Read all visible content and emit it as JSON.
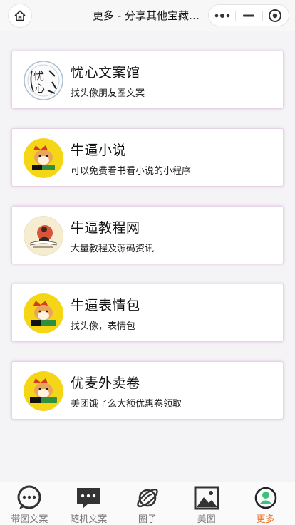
{
  "navbar": {
    "title": "更多 - 分享其他宝藏小程序"
  },
  "items": [
    {
      "title": "忧心文案馆",
      "desc": "找头像朋友圈文案",
      "icon": "youxin-logo-icon"
    },
    {
      "title": "牛逼小说",
      "desc": "可以免费看书看小说的小程序",
      "icon": "shiba-novel-icon"
    },
    {
      "title": "牛逼教程网",
      "desc": "大量教程及源码资讯",
      "icon": "tutorial-logo-icon"
    },
    {
      "title": "牛逼表情包",
      "desc": "找头像，表情包",
      "icon": "shiba-sticker-icon"
    },
    {
      "title": "优麦外卖卷",
      "desc": "美团饿了么大额优惠卷领取",
      "icon": "shiba-takeaway-icon"
    }
  ],
  "tabs": [
    {
      "label": "带图文案",
      "icon": "chat-bubble-icon",
      "active": false
    },
    {
      "label": "随机文案",
      "icon": "message-icon",
      "active": false
    },
    {
      "label": "圈子",
      "icon": "planet-icon",
      "active": false
    },
    {
      "label": "美图",
      "icon": "image-icon",
      "active": false
    },
    {
      "label": "更多",
      "icon": "user-icon",
      "active": true
    }
  ],
  "colors": {
    "accent": "#e8742c",
    "active_icon": "#3ec07a",
    "card_border": "#e7d3e6"
  }
}
